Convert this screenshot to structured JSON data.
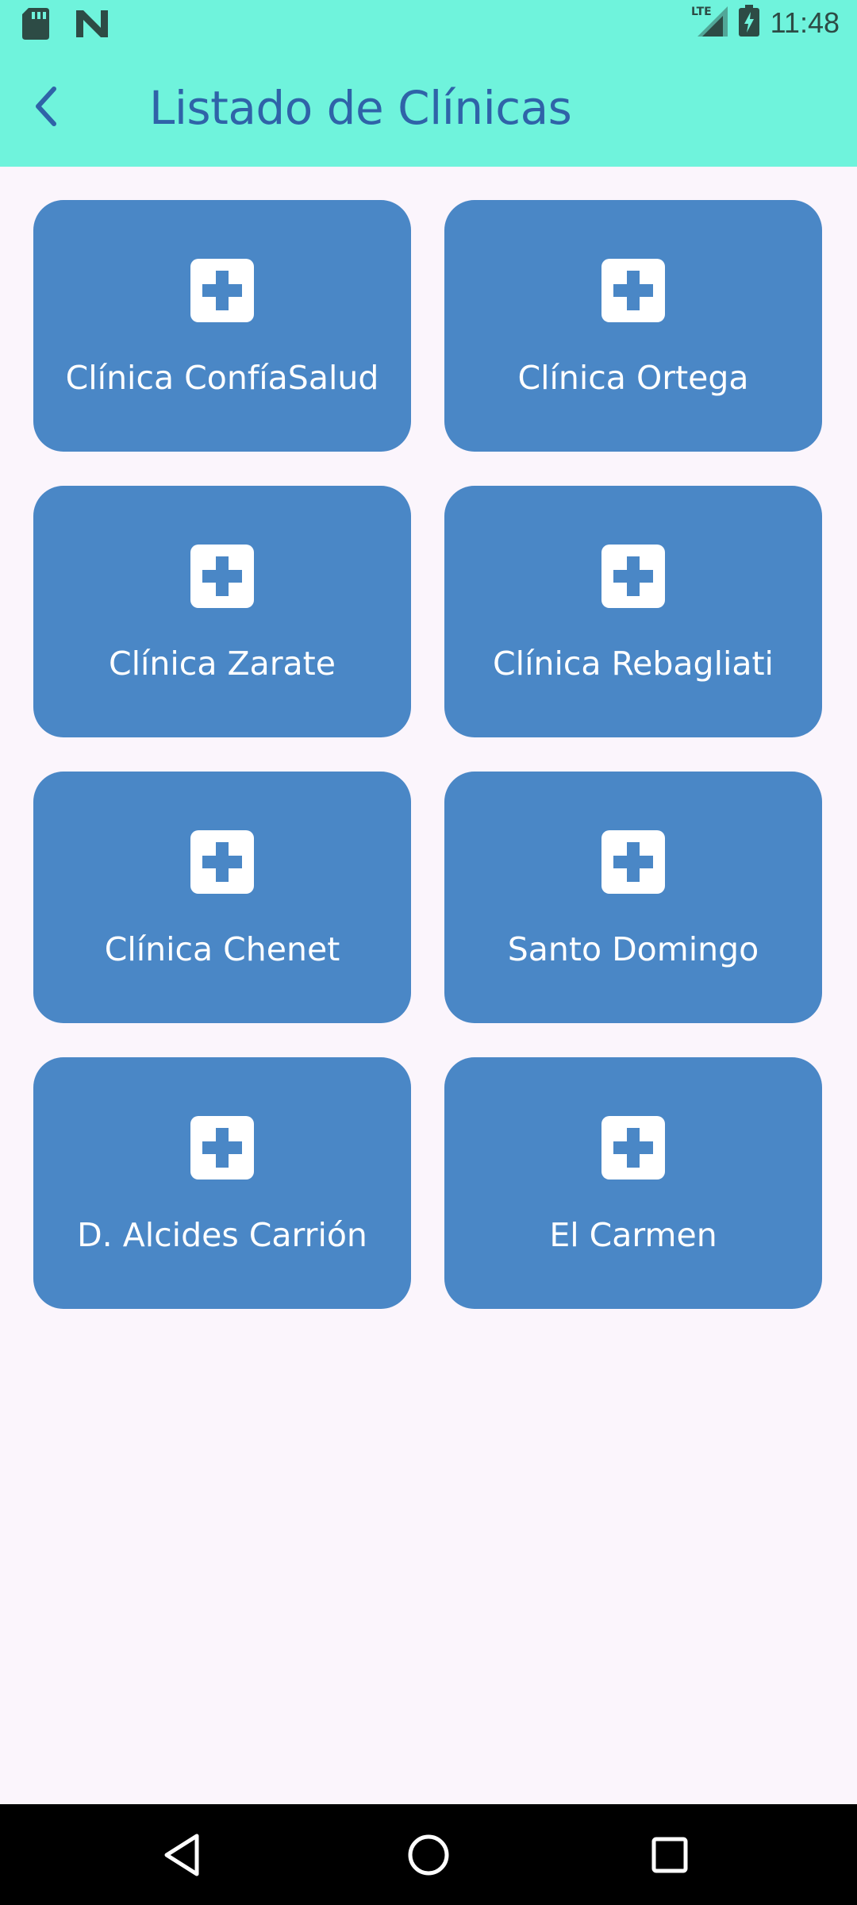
{
  "status_bar": {
    "time": "11:48",
    "network": "LTE",
    "left_icons": [
      "sd-card-icon",
      "n-logo-icon"
    ],
    "right_icons": [
      "lte-signal-icon",
      "battery-charging-icon"
    ]
  },
  "app_bar": {
    "title": "Listado de Clínicas",
    "back_icon": "chevron-left-icon",
    "background_color": "#6ff3dc",
    "title_color": "#2f63a8"
  },
  "clinics": [
    {
      "label": "Clínica ConfíaSalud",
      "icon": "medical-cross-icon"
    },
    {
      "label": "Clínica Ortega",
      "icon": "medical-cross-icon"
    },
    {
      "label": "Clínica Zarate",
      "icon": "medical-cross-icon"
    },
    {
      "label": "Clínica Rebagliati",
      "icon": "medical-cross-icon"
    },
    {
      "label": "Clínica Chenet",
      "icon": "medical-cross-icon"
    },
    {
      "label": "Santo Domingo",
      "icon": "medical-cross-icon"
    },
    {
      "label": "D. Alcides Carrión",
      "icon": "medical-cross-icon"
    },
    {
      "label": "El Carmen",
      "icon": "medical-cross-icon"
    }
  ],
  "card_color": "#4a87c6",
  "page_background": "#fbf5fc",
  "nav_bar": {
    "buttons": [
      "back-triangle-icon",
      "home-circle-icon",
      "recents-square-icon"
    ]
  }
}
